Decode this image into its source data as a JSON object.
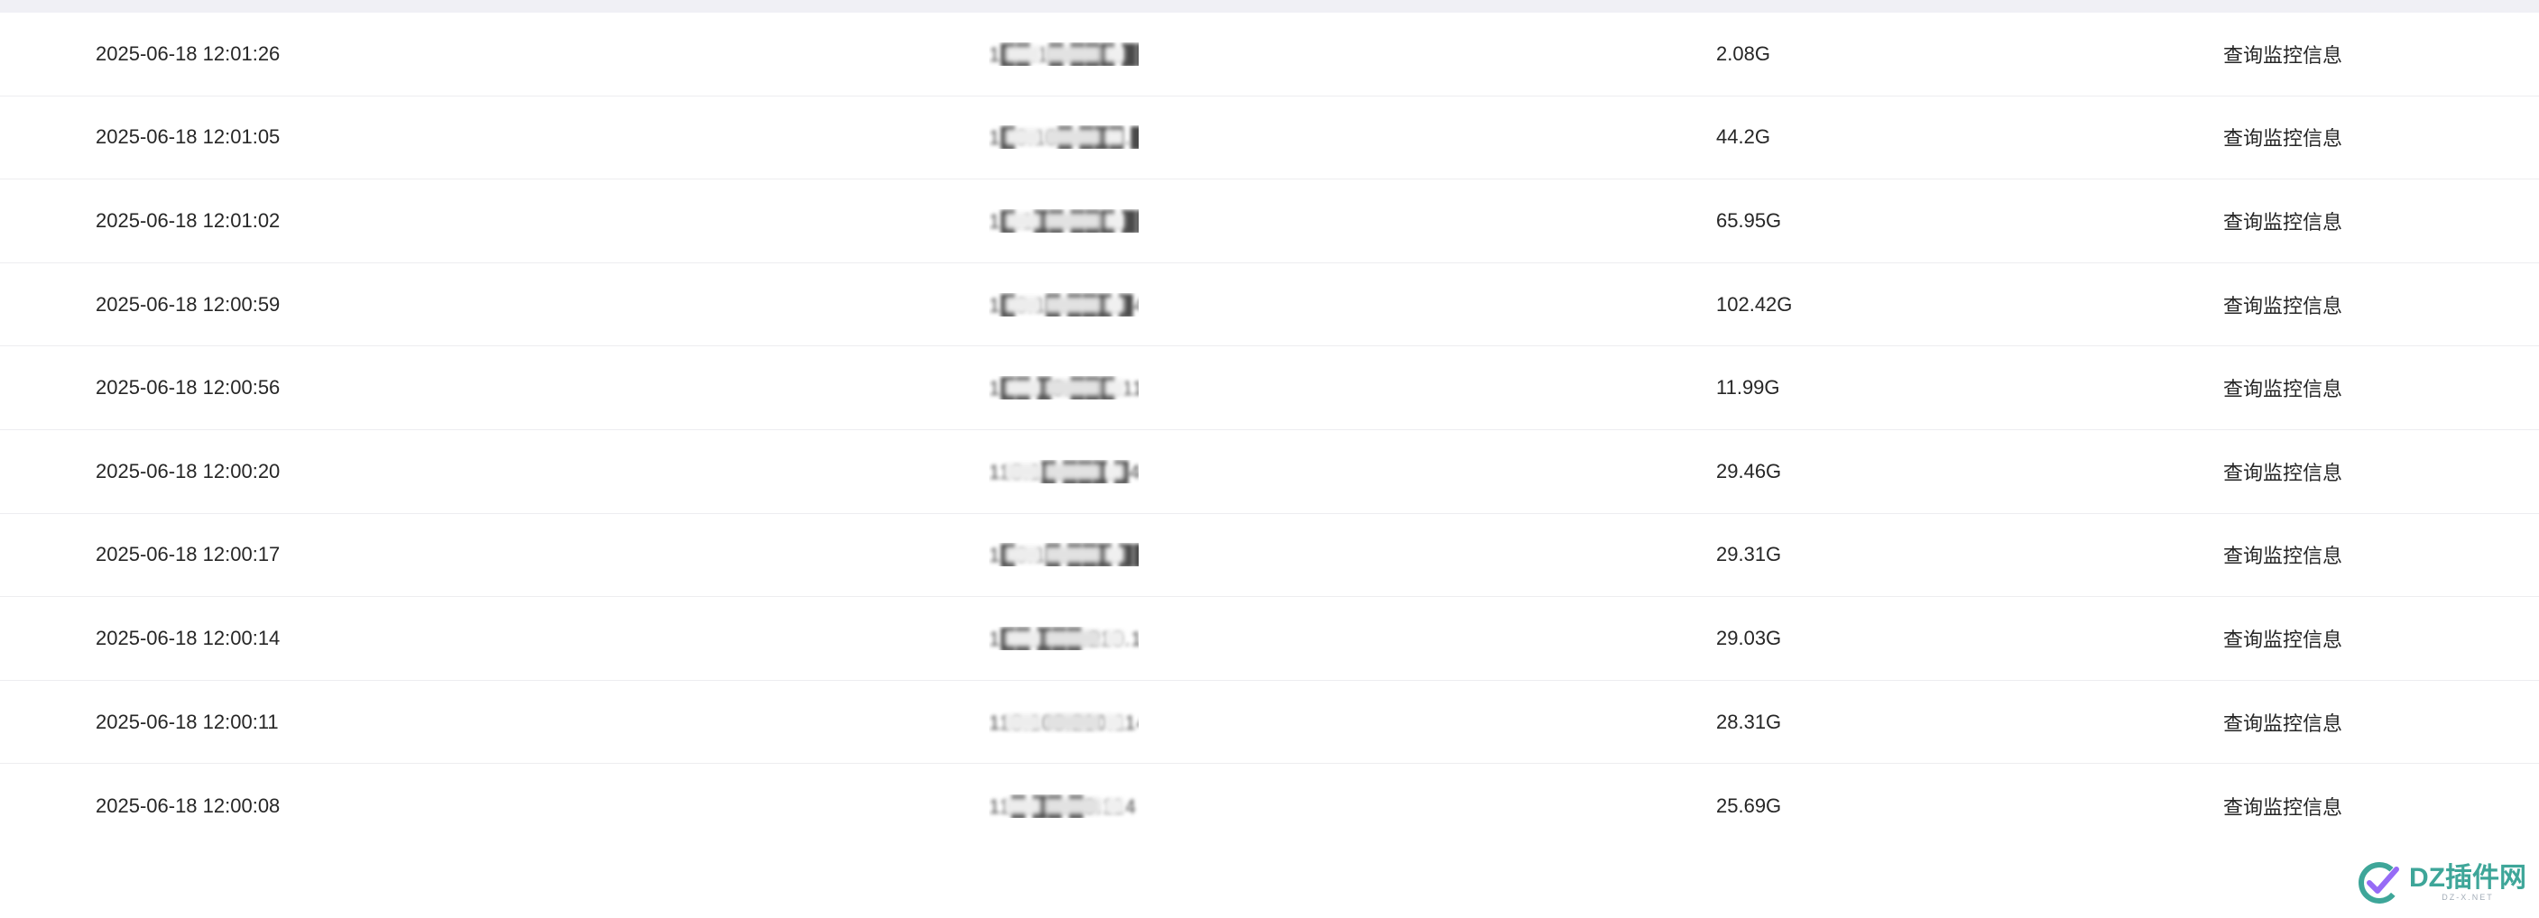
{
  "table": {
    "rows": [
      {
        "time": "2025-06-18 12:01:26",
        "ip": "1██.1█.███.██4",
        "size": "2.08G",
        "action": "查询监控信息"
      },
      {
        "time": "2025-06-18 12:01:05",
        "ip": "1█0.10█.███.█14",
        "size": "44.2G",
        "action": "查询监控信息"
      },
      {
        "time": "2025-06-18 12:01:02",
        "ip": "1█.1██.███.██",
        "size": "65.95G",
        "action": "查询监控信息"
      },
      {
        "time": "2025-06-18 12:00:59",
        "ip": "1█0.1█.███.█4",
        "size": "102.42G",
        "action": "查询监控信息"
      },
      {
        "time": "2025-06-18 12:00:56",
        "ip": "1██.█0.███.114",
        "size": "11.99G",
        "action": "查询监控信息"
      },
      {
        "time": "2025-06-18 12:00:20",
        "ip": "110.1█.███.█4",
        "size": "29.46G",
        "action": "查询监控信息"
      },
      {
        "time": "2025-06-18 12:00:17",
        "ip": "1█0.1█.███.██",
        "size": "29.31G",
        "action": "查询监控信息"
      },
      {
        "time": "2025-06-18 12:00:14",
        "ip": "1██.███.210.114",
        "size": "29.03G",
        "action": "查询监控信息"
      },
      {
        "time": "2025-06-18 12:00:11",
        "ip": "110.100.210.114",
        "size": "28.31G",
        "action": "查询监控信息"
      },
      {
        "time": "2025-06-18 12:00:08",
        "ip": "11█.██.█0.114",
        "size": "25.69G",
        "action": "查询监控信息"
      }
    ]
  },
  "watermark": {
    "title": "DZ插件网",
    "subtitle": "DZ-X.NET",
    "colors": {
      "check": "#2a9d8f",
      "accent": "#8b5cf6"
    }
  }
}
